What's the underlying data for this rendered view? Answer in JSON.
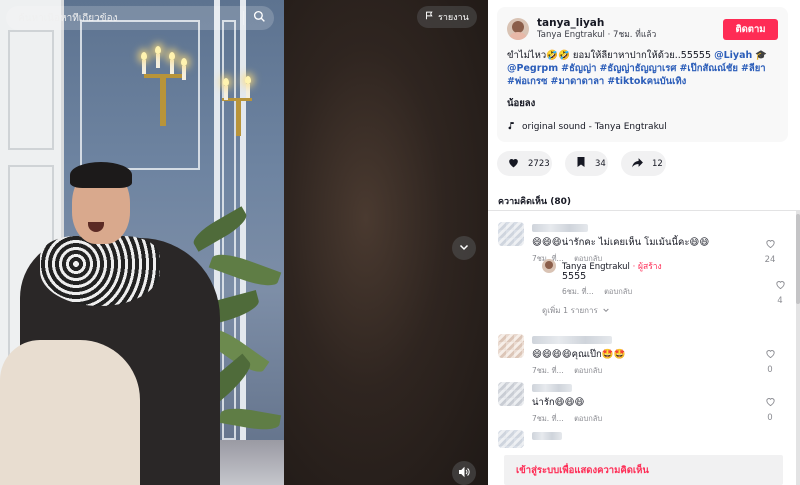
{
  "search": {
    "placeholder": "ค้นหาเนื้อหาที่เกี่ยวข้อง"
  },
  "video": {
    "report_label": "รายงาน"
  },
  "post": {
    "username": "tanya_liyah",
    "display_name": "Tanya Engtrakul",
    "time_ago": "7ชม. ที่แล้ว",
    "follow_label": "ติดตาม",
    "caption": "ขำไม่ไหว🤣🤣 ยอมให้ลียาหาปากให้ด้วย..55555",
    "mention_1": "@Liyah",
    "mention_2": "@Pegrpm",
    "hashtags": [
      "#ธัญญ่า",
      "#ธัญญ่าธัญญาเรศ",
      "#เป๊กสัณณ์ชัย",
      "#ลียา",
      "#พ่อเกรซ",
      "#มาดาดาลา",
      "#tiktokคนบันเทิง"
    ],
    "less_label": "น้อยลง",
    "sound": "original sound - Tanya Engtrakul"
  },
  "actions": {
    "likes": "2723",
    "saves": "34",
    "shares": "12"
  },
  "comments": {
    "title": "ความคิดเห็น (80)",
    "items": [
      {
        "text": "😄😄😄น่ารักคะ ไม่เคยเห็น โมเม้นนี้คะ😄😄",
        "time": "7ชม. ที่...",
        "reply": "ตอบกลับ",
        "likes": "24"
      },
      {
        "text": "😄😄😄😄คุณเป๊ก🤩🤩",
        "time": "7ชม. ที่...",
        "reply": "ตอบกลับ",
        "likes": "0"
      },
      {
        "text": "น่ารัก😄😄😄",
        "time": "7ชม. ที่...",
        "reply": "ตอบกลับ",
        "likes": "0"
      }
    ],
    "reply": {
      "name": "Tanya Engtrakul",
      "creator_tag": "· ผู้สร้าง",
      "text": "5555",
      "time": "6ชม. ที่...",
      "reply": "ตอบกลับ",
      "likes": "4"
    },
    "more_replies": "ดูเพิ่ม 1 รายการ"
  },
  "login_prompt": "เข้าสู่ระบบเพื่อแสดงความคิดเห็น",
  "colors": {
    "accent": "#fe2c55",
    "tag": "#2b5db9"
  }
}
